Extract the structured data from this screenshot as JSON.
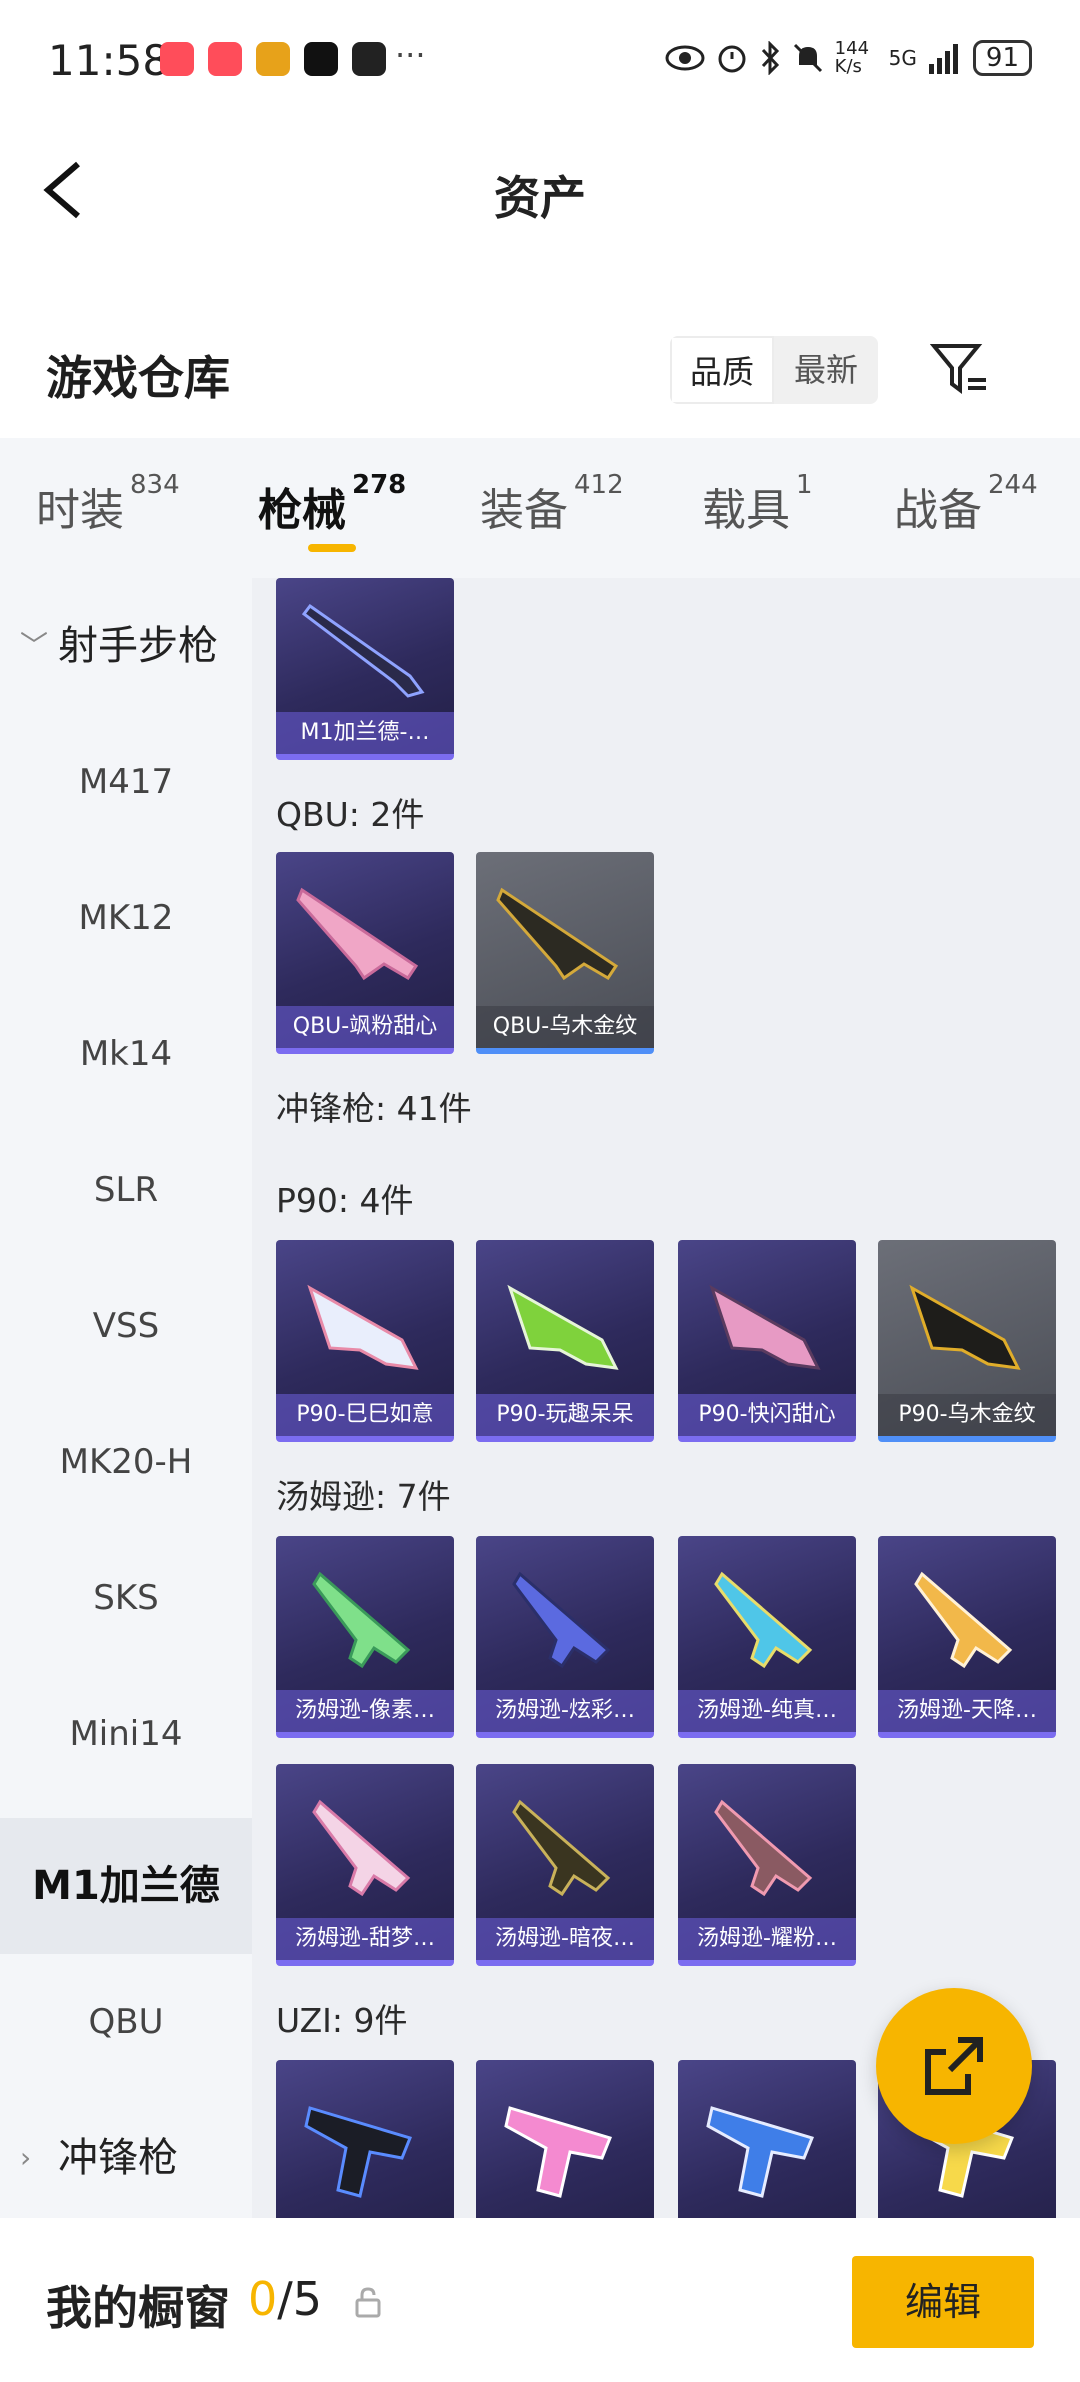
{
  "status_bar": {
    "time": "11:58",
    "more": "···",
    "net_speed": "144 K/s",
    "signal": "5G",
    "battery": "91",
    "icons": [
      "eye-icon",
      "alarm-icon",
      "bluetooth-icon",
      "mute-icon",
      "signal-icon",
      "battery-icon"
    ]
  },
  "nav": {
    "title": "资产"
  },
  "warehouse": {
    "title": "游戏仓库",
    "sort": {
      "quality": "品质",
      "newest": "最新",
      "active": "品质"
    }
  },
  "tabs": [
    {
      "label": "时装",
      "count": "834"
    },
    {
      "label": "枪械",
      "count": "278",
      "active": true
    },
    {
      "label": "装备",
      "count": "412"
    },
    {
      "label": "载具",
      "count": "1"
    },
    {
      "label": "战备",
      "count": "244"
    }
  ],
  "sidebar": {
    "group_top": "射手步枪",
    "items": [
      "M417",
      "MK12",
      "Mk14",
      "SLR",
      "VSS",
      "MK20-H",
      "SKS",
      "Mini14",
      "M1加兰德",
      "QBU"
    ],
    "active": "M1加兰德",
    "group_bottom": "冲锋枪"
  },
  "content": {
    "m1_card": "M1加兰德-…",
    "qbu_label": "QBU: 2件",
    "qbu_cards": [
      "QBU-飒粉甜心",
      "QBU-乌木金纹"
    ],
    "smg_label": "冲锋枪: 41件",
    "p90_label": "P90: 4件",
    "p90_cards": [
      "P90-巳巳如意",
      "P90-玩趣呆呆",
      "P90-快闪甜心",
      "P90-乌木金纹"
    ],
    "tommy_label": "汤姆逊: 7件",
    "tommy_cards": [
      "汤姆逊-像素…",
      "汤姆逊-炫彩…",
      "汤姆逊-纯真…",
      "汤姆逊-天降…",
      "汤姆逊-甜梦…",
      "汤姆逊-暗夜…",
      "汤姆逊-耀粉…"
    ],
    "uzi_label": "UZI: 9件"
  },
  "bottom_bar": {
    "title": "我的橱窗",
    "used": "0",
    "total": "/5",
    "edit": "编辑"
  },
  "colors": {
    "accent": "#f7b500",
    "card_purple": "#3a356f",
    "card_gray": "#5b5e66",
    "sidebar_bg": "#f4f6f9"
  }
}
